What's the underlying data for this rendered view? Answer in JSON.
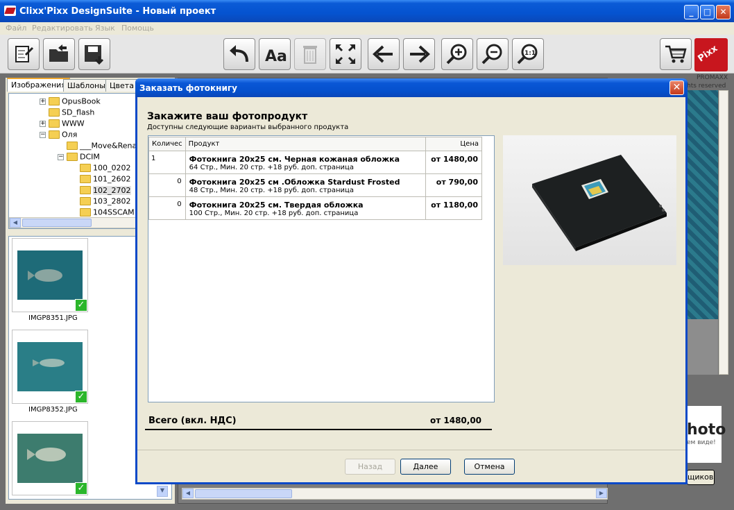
{
  "window": {
    "title": "Clixx'Pixx DesignSuite - Новый проект"
  },
  "menu": [
    "Файл",
    "Редактировать",
    "Язык",
    "Помощь"
  ],
  "brand": {
    "logo_text": "Pixx",
    "company": "PROMAXX",
    "rights": "hts reserved"
  },
  "left_tabs": [
    "Изображения",
    "Шаблоны",
    "Цвета"
  ],
  "tree": [
    {
      "label": "OpusBook",
      "expander": "+"
    },
    {
      "label": "SD_flash",
      "expander": ""
    },
    {
      "label": "WWW",
      "expander": "+"
    },
    {
      "label": "Оля",
      "expander": "−"
    },
    {
      "label": "___Move&Renam",
      "expander": ""
    },
    {
      "label": "DCIM",
      "expander": "−"
    },
    {
      "label": "100_0202",
      "expander": ""
    },
    {
      "label": "101_2602",
      "expander": ""
    },
    {
      "label": "102_2702",
      "expander": ""
    },
    {
      "label": "103_2802",
      "expander": ""
    },
    {
      "label": "104SSCAM",
      "expander": ""
    }
  ],
  "thumbnails": [
    {
      "filename": "IMGP8351.JPG"
    },
    {
      "filename": "IMGP8352.JPG"
    },
    {
      "filename": ""
    }
  ],
  "ad": {
    "big": "hoto",
    "small": "ем виде!",
    "button": "щиков"
  },
  "dialog": {
    "title": "Заказать фотокнигу",
    "heading": "Закажите ваш фотопродукт",
    "subheading": "Доступны следующие варианты выбранного продукта",
    "columns": {
      "qty": "Количес",
      "product": "Продукт",
      "price": "Цена"
    },
    "products": [
      {
        "qty": "1",
        "name": "Фотокнига 20x25 см. Черная кожаная обложка",
        "desc": "64 Стр., Мин. 20 стр. +18 руб. доп. страница",
        "price": "от 1480,00"
      },
      {
        "qty": "0",
        "name": "Фотокнига 20x25 см .Обложка Stardust Frosted",
        "desc": "48 Стр., Мин. 20 стр. +18 руб. доп. страница",
        "price": "от 790,00"
      },
      {
        "qty": "0",
        "name": "Фотокнига 20x25 см. Твердая обложка",
        "desc": "100 Стр., Мин. 20 стр. +18 руб. доп. страница",
        "price": "от 1180,00"
      }
    ],
    "total_label": "Всего (вкл. НДС)",
    "total_value": "от 1480,00",
    "buttons": {
      "back": "Назад",
      "next": "Далее",
      "cancel": "Отмена"
    }
  }
}
